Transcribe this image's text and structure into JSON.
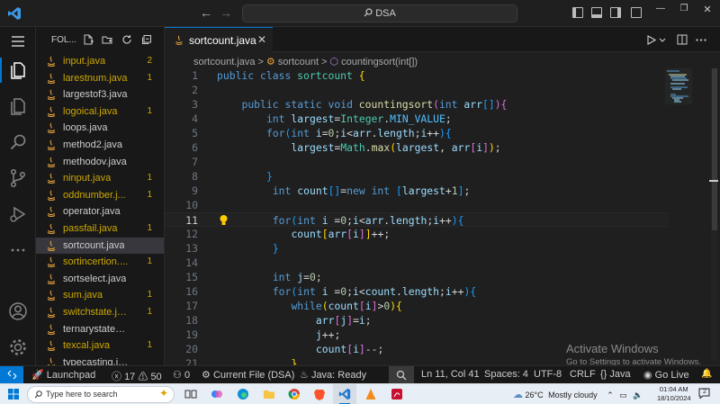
{
  "titlebar": {
    "search_text": "DSA",
    "back": "←",
    "forward": "→",
    "minimize": "—",
    "restore": "❐",
    "close": "✕"
  },
  "sidebar": {
    "title": "FOL...",
    "files": [
      {
        "name": "input.java",
        "badge": "2",
        "color": "#cca700"
      },
      {
        "name": "larestnum.java",
        "badge": "1",
        "color": "#cca700"
      },
      {
        "name": "largestof3.java",
        "badge": "",
        "color": "#cccccc"
      },
      {
        "name": "logoical.java",
        "badge": "1",
        "color": "#cca700"
      },
      {
        "name": "loops.java",
        "badge": "",
        "color": "#cccccc"
      },
      {
        "name": "method2.java",
        "badge": "",
        "color": "#cccccc"
      },
      {
        "name": "methodov.java",
        "badge": "",
        "color": "#cccccc"
      },
      {
        "name": "ninput.java",
        "badge": "1",
        "color": "#cca700"
      },
      {
        "name": "oddnumber.j...",
        "badge": "1",
        "color": "#cca700"
      },
      {
        "name": "operator.java",
        "badge": "",
        "color": "#cccccc"
      },
      {
        "name": "passfail.java",
        "badge": "1",
        "color": "#cca700"
      },
      {
        "name": "sortcount.java",
        "badge": "",
        "color": "#cccccc",
        "selected": true
      },
      {
        "name": "sortincertion....",
        "badge": "1",
        "color": "#cca700"
      },
      {
        "name": "sortselect.java",
        "badge": "",
        "color": "#cccccc"
      },
      {
        "name": "sum.java",
        "badge": "1",
        "color": "#cca700"
      },
      {
        "name": "switchstate.ja...",
        "badge": "1",
        "color": "#cca700"
      },
      {
        "name": "ternarystatement....",
        "badge": "",
        "color": "#cccccc"
      },
      {
        "name": "texcal.java",
        "badge": "1",
        "color": "#cca700"
      },
      {
        "name": "typecasting.java",
        "badge": "",
        "color": "#cccccc"
      }
    ]
  },
  "editor": {
    "tab_label": "sortcount.java",
    "tab_close": "✕",
    "breadcrumb": {
      "file": "sortcount.java",
      "sep1": ">",
      "class": "sortcount",
      "sep2": ">",
      "method": "countingsort(int[])"
    },
    "lines": [
      {
        "n": "1",
        "indent": 0,
        "tokens": [
          [
            "public ",
            "kw"
          ],
          [
            "class ",
            "kw"
          ],
          [
            "sortcount ",
            "ty"
          ],
          [
            "{",
            "b1"
          ]
        ]
      },
      {
        "n": "2",
        "indent": 0,
        "tokens": []
      },
      {
        "n": "3",
        "indent": 4,
        "tokens": [
          [
            "public ",
            "kw"
          ],
          [
            "static ",
            "kw"
          ],
          [
            "void ",
            "kw"
          ],
          [
            "countingsort",
            "fn"
          ],
          [
            "(",
            "b2"
          ],
          [
            "int ",
            "kw"
          ],
          [
            "arr",
            "vr"
          ],
          [
            "[]",
            "b3"
          ],
          [
            ")",
            "b2"
          ],
          [
            "{",
            "b2"
          ]
        ]
      },
      {
        "n": "4",
        "indent": 8,
        "tokens": [
          [
            "int ",
            "kw"
          ],
          [
            "largest",
            "vr"
          ],
          [
            "=",
            "pl"
          ],
          [
            "Integer",
            "ty"
          ],
          [
            ".",
            "pl"
          ],
          [
            "MIN_VALUE",
            "co"
          ],
          [
            ";",
            "pl"
          ]
        ]
      },
      {
        "n": "5",
        "indent": 8,
        "tokens": [
          [
            "for",
            "kw"
          ],
          [
            "(",
            "b3"
          ],
          [
            "int ",
            "kw"
          ],
          [
            "i",
            "vr"
          ],
          [
            "=",
            "pl"
          ],
          [
            "0",
            "nm"
          ],
          [
            ";",
            "pl"
          ],
          [
            "i",
            "vr"
          ],
          [
            "<",
            "pl"
          ],
          [
            "arr",
            "vr"
          ],
          [
            ".",
            "pl"
          ],
          [
            "length",
            "vr"
          ],
          [
            ";",
            "pl"
          ],
          [
            "i",
            "vr"
          ],
          [
            "++",
            "pl"
          ],
          [
            ")",
            "b3"
          ],
          [
            "{",
            "b3"
          ]
        ]
      },
      {
        "n": "6",
        "indent": 12,
        "tokens": [
          [
            "largest",
            "vr"
          ],
          [
            "=",
            "pl"
          ],
          [
            "Math",
            "ty"
          ],
          [
            ".",
            "pl"
          ],
          [
            "max",
            "fn"
          ],
          [
            "(",
            "b1"
          ],
          [
            "largest",
            "vr"
          ],
          [
            ", ",
            "pl"
          ],
          [
            "arr",
            "vr"
          ],
          [
            "[",
            "b2"
          ],
          [
            "i",
            "vr"
          ],
          [
            "]",
            "b2"
          ],
          [
            ")",
            "b1"
          ],
          [
            ";",
            "pl"
          ]
        ]
      },
      {
        "n": "7",
        "indent": 0,
        "tokens": []
      },
      {
        "n": "8",
        "indent": 8,
        "tokens": [
          [
            "}",
            "b3"
          ]
        ]
      },
      {
        "n": "9",
        "indent": 9,
        "tokens": [
          [
            "int ",
            "kw"
          ],
          [
            "count",
            "vr"
          ],
          [
            "[]",
            "b3"
          ],
          [
            "=",
            "pl"
          ],
          [
            "new ",
            "kw"
          ],
          [
            "int ",
            "kw"
          ],
          [
            "[",
            "b3"
          ],
          [
            "largest",
            "vr"
          ],
          [
            "+",
            "pl"
          ],
          [
            "1",
            "nm"
          ],
          [
            "]",
            "b3"
          ],
          [
            ";",
            "pl"
          ]
        ]
      },
      {
        "n": "10",
        "indent": 0,
        "tokens": []
      },
      {
        "n": "11",
        "indent": 9,
        "current": true,
        "bulb": true,
        "tokens": [
          [
            "for",
            "kw"
          ],
          [
            "(",
            "b3"
          ],
          [
            "int ",
            "kw"
          ],
          [
            "i ",
            "vr"
          ],
          [
            "=",
            "pl"
          ],
          [
            "0",
            "nm"
          ],
          [
            ";",
            "pl"
          ],
          [
            "i",
            "vr"
          ],
          [
            "<",
            "pl"
          ],
          [
            "arr",
            "vr"
          ],
          [
            ".",
            "pl"
          ],
          [
            "length",
            "vr"
          ],
          [
            ";",
            "pl"
          ],
          [
            "i",
            "vr"
          ],
          [
            "++",
            "pl"
          ],
          [
            ")",
            "b3"
          ],
          [
            "{",
            "b3"
          ]
        ]
      },
      {
        "n": "12",
        "indent": 12,
        "tokens": [
          [
            "count",
            "vr"
          ],
          [
            "[",
            "b1"
          ],
          [
            "arr",
            "vr"
          ],
          [
            "[",
            "b2"
          ],
          [
            "i",
            "vr"
          ],
          [
            "]",
            "b2"
          ],
          [
            "]",
            "b1"
          ],
          [
            "++",
            "pl"
          ],
          [
            ";",
            "pl"
          ]
        ]
      },
      {
        "n": "13",
        "indent": 9,
        "tokens": [
          [
            "}",
            "b3"
          ]
        ]
      },
      {
        "n": "14",
        "indent": 0,
        "tokens": []
      },
      {
        "n": "15",
        "indent": 9,
        "tokens": [
          [
            "int ",
            "kw"
          ],
          [
            "j",
            "vr"
          ],
          [
            "=",
            "pl"
          ],
          [
            "0",
            "nm"
          ],
          [
            ";",
            "pl"
          ]
        ]
      },
      {
        "n": "16",
        "indent": 9,
        "tokens": [
          [
            "for",
            "kw"
          ],
          [
            "(",
            "b3"
          ],
          [
            "int ",
            "kw"
          ],
          [
            "i ",
            "vr"
          ],
          [
            "=",
            "pl"
          ],
          [
            "0",
            "nm"
          ],
          [
            ";",
            "pl"
          ],
          [
            "i",
            "vr"
          ],
          [
            "<",
            "pl"
          ],
          [
            "count",
            "vr"
          ],
          [
            ".",
            "pl"
          ],
          [
            "length",
            "vr"
          ],
          [
            ";",
            "pl"
          ],
          [
            "i",
            "vr"
          ],
          [
            "++",
            "pl"
          ],
          [
            ")",
            "b3"
          ],
          [
            "{",
            "b3"
          ]
        ]
      },
      {
        "n": "17",
        "indent": 12,
        "tokens": [
          [
            "while",
            "kw"
          ],
          [
            "(",
            "b1"
          ],
          [
            "count",
            "vr"
          ],
          [
            "[",
            "b2"
          ],
          [
            "i",
            "vr"
          ],
          [
            "]",
            "b2"
          ],
          [
            ">",
            "pl"
          ],
          [
            "0",
            "nm"
          ],
          [
            ")",
            "b1"
          ],
          [
            "{",
            "b1"
          ]
        ]
      },
      {
        "n": "18",
        "indent": 16,
        "tokens": [
          [
            "arr",
            "vr"
          ],
          [
            "[",
            "b2"
          ],
          [
            "j",
            "vr"
          ],
          [
            "]",
            "b2"
          ],
          [
            "=",
            "pl"
          ],
          [
            "i",
            "vr"
          ],
          [
            ";",
            "pl"
          ]
        ]
      },
      {
        "n": "19",
        "indent": 16,
        "tokens": [
          [
            "j",
            "vr"
          ],
          [
            "++",
            "pl"
          ],
          [
            ";",
            "pl"
          ]
        ]
      },
      {
        "n": "20",
        "indent": 16,
        "tokens": [
          [
            "count",
            "vr"
          ],
          [
            "[",
            "b2"
          ],
          [
            "i",
            "vr"
          ],
          [
            "]",
            "b2"
          ],
          [
            "--",
            "pl"
          ],
          [
            ";",
            "pl"
          ]
        ]
      },
      {
        "n": "21",
        "indent": 12,
        "tokens": [
          [
            "}",
            "b1"
          ]
        ]
      }
    ]
  },
  "watermark": {
    "line1": "Activate Windows",
    "line2": "Go to Settings to activate Windows."
  },
  "statusbar": {
    "remote": "⚡",
    "launchpad": "Launchpad",
    "errors": "17",
    "warnings": "50",
    "ports": "0",
    "current_file": "Current File (DSA)",
    "java_status": "Java: Ready",
    "position": "Ln 11, Col 41",
    "spaces": "Spaces: 4",
    "encoding": "UTF-8",
    "eol": "CRLF",
    "language": "Java",
    "go_live": "Go Live",
    "bell": "🔔"
  },
  "taskbar": {
    "search_placeholder": "Type here to search",
    "weather_temp": "26°C",
    "weather_desc": "Mostly cloudy",
    "time": "01:04 AM",
    "date": "18/10/2024",
    "notifications": "2"
  },
  "colors": {
    "accent": "#0078d4",
    "git_modified": "#cca700",
    "editor_bg": "#1f1f1f",
    "sidebar_bg": "#181818"
  }
}
